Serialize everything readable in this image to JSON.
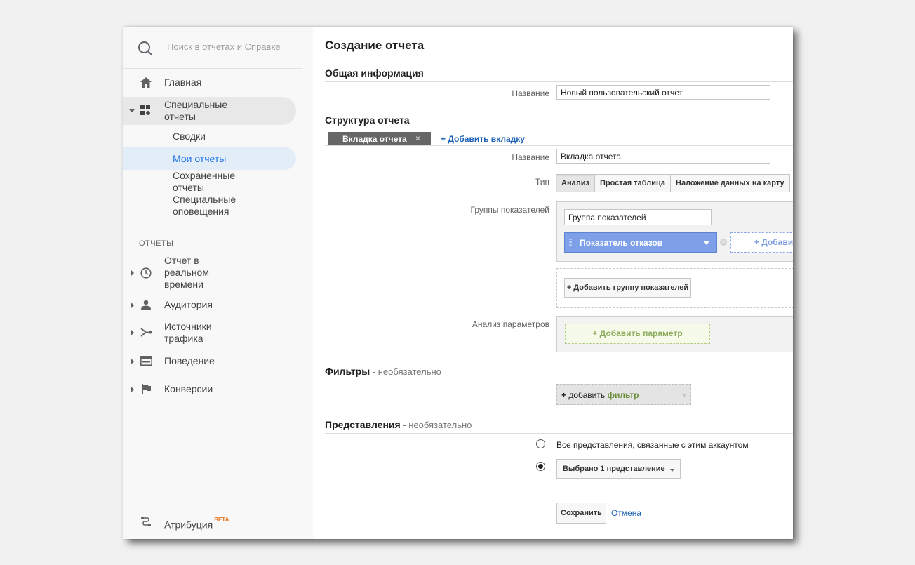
{
  "sidebar": {
    "search_placeholder": "Поиск в отчетах и Справке",
    "home": "Главная",
    "custom_reports": "Специальные отчеты",
    "sub_items": [
      "Сводки",
      "Мои отчеты",
      "Сохраненные отчеты",
      "Специальные оповещения"
    ],
    "section_reports": "ОТЧЕТЫ",
    "report_items": [
      "Отчет в реальном времени",
      "Аудитория",
      "Источники трафика",
      "Поведение",
      "Конверсии"
    ],
    "attribution": "Атрибуция",
    "beta": "BETA"
  },
  "main": {
    "title": "Создание отчета",
    "general": {
      "heading": "Общая информация",
      "name_label": "Название",
      "name_value": "Новый пользовательский отчет"
    },
    "structure": {
      "heading": "Структура отчета",
      "tab_label": "Вкладка отчета",
      "tab_close": "×",
      "add_tab": "+ Добавить вкладку",
      "name_label": "Название",
      "name_value": "Вкладка отчета",
      "type_label": "Тип",
      "types": [
        "Анализ",
        "Простая таблица",
        "Наложение данных на карту"
      ],
      "selected_type": "Анализ",
      "metric_groups_label": "Группы показателей",
      "metric_group_name": "Группа показателей",
      "metric": "Показатель отказов",
      "add_metric": "+ Добавить показатель",
      "add_metric_group": "+ Добавить группу показателей",
      "dimensions_label": "Анализ параметров",
      "add_dimension": "+ Добавить параметр"
    },
    "filters": {
      "heading": "Фильтры",
      "optional": " - необязательно",
      "add_prefix": "+ ",
      "add_word": "добавить",
      "add_filter_word": "фильтр"
    },
    "views": {
      "heading": "Представления",
      "optional": " - необязательно",
      "option_all": "Все представления, связанные с этим аккаунтом",
      "option_selected": "Выбрано 1 представление",
      "selected_option": "selected"
    },
    "actions": {
      "save": "Сохранить",
      "cancel": "Отмена"
    }
  },
  "colors": {
    "metric_pill": "#7da0e8",
    "dimension_box": "#f6fae9",
    "link": "#1a5fb4",
    "selected_nav": "#e3edf8"
  }
}
